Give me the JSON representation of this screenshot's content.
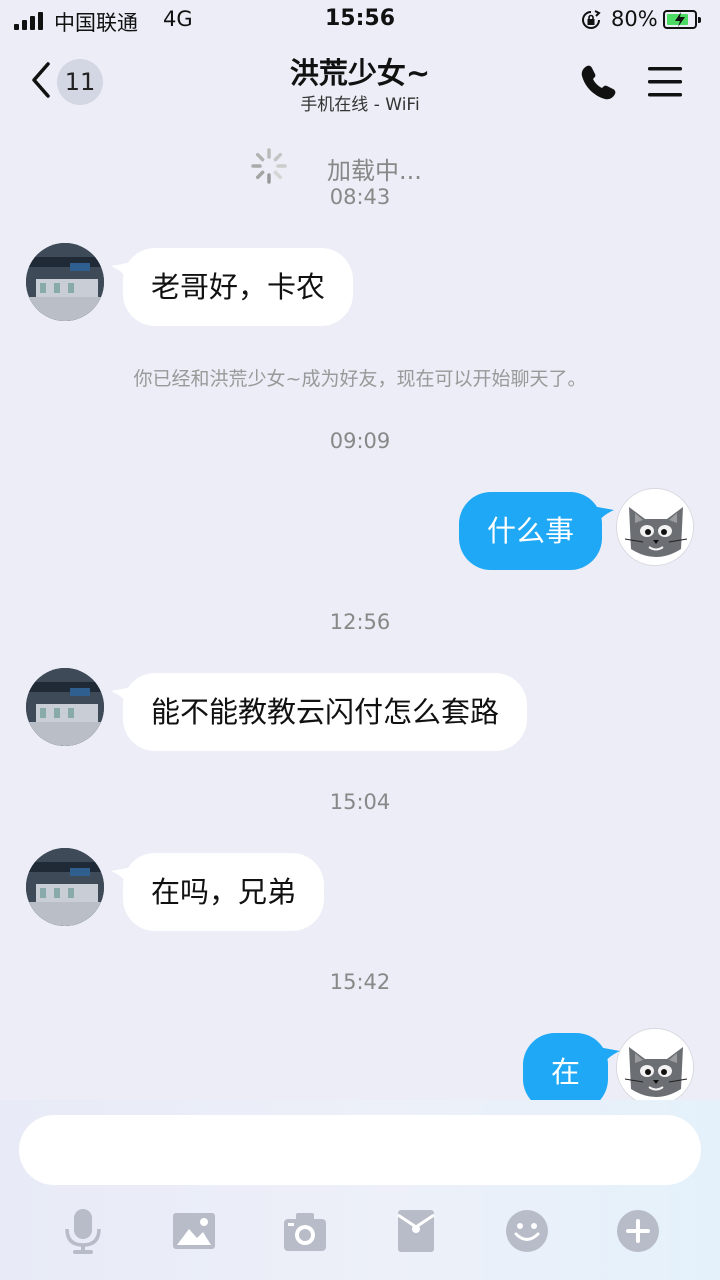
{
  "status_bar": {
    "carrier": "中国联通",
    "network": "4G",
    "time": "15:56",
    "battery": "80%",
    "battery_level": 0.8
  },
  "nav": {
    "unread_count": "11",
    "title": "洪荒少女~",
    "subtitle": "手机在线 - WiFi"
  },
  "chat": {
    "loading_text": "加载中...",
    "system_notice": "你已经和洪荒少女~成为好友，现在可以开始聊天了。",
    "times": [
      "08:43",
      "09:09",
      "12:56",
      "15:04",
      "15:42"
    ],
    "messages": [
      {
        "from": "contact",
        "text": "老哥好，卡农"
      },
      {
        "from": "me",
        "text": "什么事"
      },
      {
        "from": "contact",
        "text": "能不能教教云闪付怎么套路"
      },
      {
        "from": "contact",
        "text": "在吗，兄弟"
      },
      {
        "from": "me",
        "text": "在"
      }
    ]
  },
  "input": {
    "value": "",
    "placeholder": ""
  },
  "toolbar": {
    "icons": [
      "microphone-icon",
      "image-icon",
      "camera-icon",
      "red-packet-icon",
      "emoji-icon",
      "plus-icon"
    ]
  },
  "colors": {
    "background": "#ecedf6",
    "outgoing_bubble": "#1ea8f5",
    "incoming_bubble": "#ffffff"
  }
}
